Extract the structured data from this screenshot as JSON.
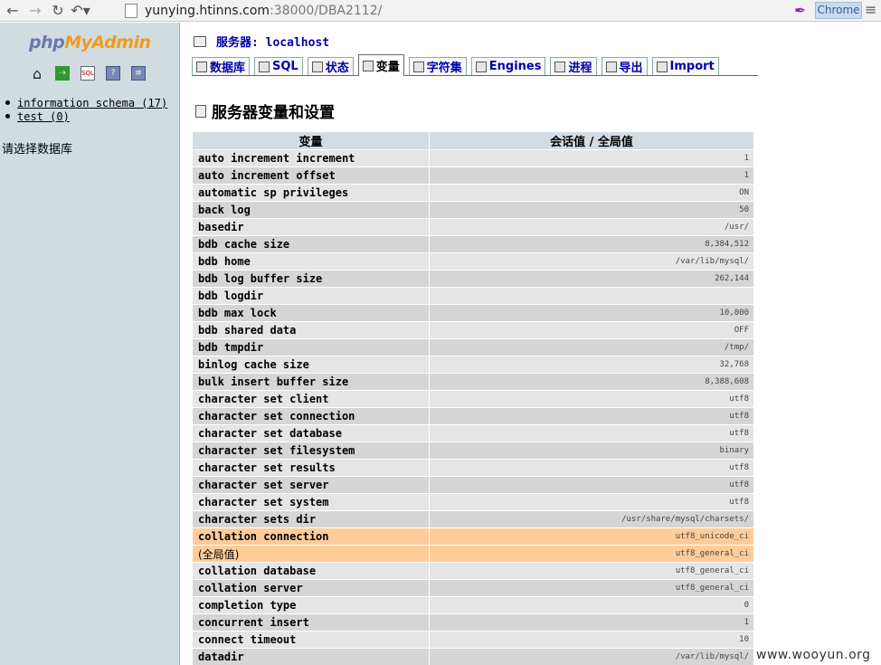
{
  "browser": {
    "url_host": "yunying.htinns.com",
    "url_rest": ":38000/DBA2112/",
    "badge": "Chrome",
    "back_icon": "arrow-left-icon",
    "forward_icon": "arrow-right-icon",
    "reload_icon": "reload-icon",
    "undo_icon": "undo-icon"
  },
  "left": {
    "logo_php": "php",
    "logo_myadmin": "MyAdmin",
    "databases": [
      {
        "label": "information schema (17)"
      },
      {
        "label": "test (0)"
      }
    ],
    "select_db": "请选择数据库"
  },
  "right": {
    "server_label": "服务器: localhost",
    "tabs": [
      {
        "label": "数据库"
      },
      {
        "label": "SQL"
      },
      {
        "label": "状态"
      },
      {
        "label": "变量"
      },
      {
        "label": "字符集"
      },
      {
        "label": "Engines"
      },
      {
        "label": "进程"
      },
      {
        "label": "导出"
      },
      {
        "label": "Import"
      }
    ],
    "heading": "服务器变量和设置",
    "table": {
      "col_variable": "变量",
      "col_value": "会话值 / 全局值",
      "rows": [
        {
          "name": "auto increment increment",
          "value": "1"
        },
        {
          "name": "auto increment offset",
          "value": "1"
        },
        {
          "name": "automatic sp privileges",
          "value": "ON"
        },
        {
          "name": "back log",
          "value": "50"
        },
        {
          "name": "basedir",
          "value": "/usr/"
        },
        {
          "name": "bdb cache size",
          "value": "8,384,512"
        },
        {
          "name": "bdb home",
          "value": "/var/lib/mysql/"
        },
        {
          "name": "bdb log buffer size",
          "value": "262,144"
        },
        {
          "name": "bdb logdir",
          "value": ""
        },
        {
          "name": "bdb max lock",
          "value": "10,000"
        },
        {
          "name": "bdb shared data",
          "value": "OFF"
        },
        {
          "name": "bdb tmpdir",
          "value": "/tmp/"
        },
        {
          "name": "binlog cache size",
          "value": "32,768"
        },
        {
          "name": "bulk insert buffer size",
          "value": "8,388,608"
        },
        {
          "name": "character set client",
          "value": "utf8"
        },
        {
          "name": "character set connection",
          "value": "utf8"
        },
        {
          "name": "character set database",
          "value": "utf8"
        },
        {
          "name": "character set filesystem",
          "value": "binary"
        },
        {
          "name": "character set results",
          "value": "utf8"
        },
        {
          "name": "character set server",
          "value": "utf8"
        },
        {
          "name": "character set system",
          "value": "utf8"
        },
        {
          "name": "character sets dir",
          "value": "/usr/share/mysql/charsets/"
        },
        {
          "name": "collation connection",
          "value": "utf8_unicode_ci"
        },
        {
          "name": "(全局值)",
          "value": "utf8_general_ci"
        },
        {
          "name": "collation database",
          "value": "utf8_general_ci"
        },
        {
          "name": "collation server",
          "value": "utf8_general_ci"
        },
        {
          "name": "completion type",
          "value": "0"
        },
        {
          "name": "concurrent insert",
          "value": "1"
        },
        {
          "name": "connect timeout",
          "value": "10"
        },
        {
          "name": "datadir",
          "value": "/var/lib/mysql/"
        }
      ]
    }
  },
  "watermark": "www.wooyun.org"
}
